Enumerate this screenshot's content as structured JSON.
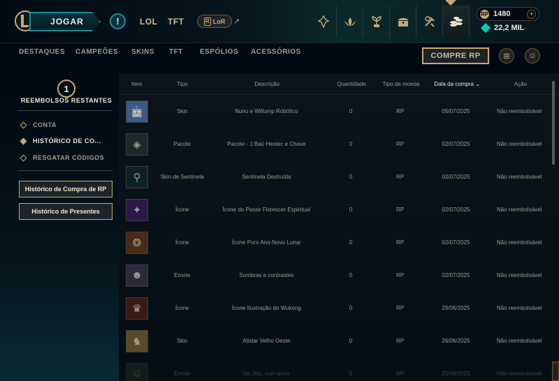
{
  "topbar": {
    "play_label": "JOGAR",
    "alert_label": "!",
    "game_tabs": [
      "LOL",
      "TFT"
    ],
    "lor_label": "LoR",
    "lor_badge": "R",
    "ext_arrow": "↗",
    "rp_amount": "1480",
    "rp_coin": "RP",
    "rp_plus": "+",
    "blue_essence": "22,2 MIL",
    "nav_icons": [
      "home-icon",
      "lotus-icon",
      "plant-icon",
      "chest-icon",
      "crafting-icon",
      "store-icon"
    ]
  },
  "store_tabs": [
    "DESTAQUES",
    "CAMPEÕES",
    "SKINS",
    "TFT",
    "ESPÓLIOS",
    "ACESSÓRIOS"
  ],
  "buy_rp_label": "COMPRE RP",
  "gift_icon_glyph": "⊞",
  "friends_icon_glyph": "☺",
  "sidebar": {
    "refund_count": "1",
    "refund_label": "REEMBOLSOS RESTANTES",
    "items": [
      {
        "label": "CONTA"
      },
      {
        "label": "HISTÓRICO DE CO..."
      },
      {
        "label": "RESGATAR CÓDIGOS"
      }
    ],
    "buttons": [
      "Histórico de Compra de RP",
      "Histórico de Presentes"
    ]
  },
  "table": {
    "headers": {
      "item": "Item",
      "tipo": "Tipo",
      "descricao": "Descrição",
      "quantidade": "Quantidade",
      "moeda": "Tipo de moeda",
      "data": "Data da compra",
      "sort_icon": "⌄",
      "acao": "Ação"
    },
    "rows": [
      {
        "thumb": "🤖",
        "bg": "#3b5a8a",
        "tipo": "Skin",
        "descricao": "Nunu e Willump Robótico",
        "quantidade": "0",
        "moeda": "RP",
        "data": "05/07/2025",
        "acao": "Não reembolsável"
      },
      {
        "thumb": "◈",
        "bg": "#1a2a2a",
        "tipo": "Pacote",
        "descricao": "Pacote - 1 Baú Hextec e Chave",
        "quantidade": "0",
        "moeda": "RP",
        "data": "02/07/2025",
        "acao": "Não reembolsável"
      },
      {
        "thumb": "⚲",
        "bg": "#0c2226",
        "tipo": "Skin de Sentinela",
        "descricao": "Sentinela Destruída",
        "quantidade": "0",
        "moeda": "RP",
        "data": "02/07/2025",
        "acao": "Não reembolsável"
      },
      {
        "thumb": "✦",
        "bg": "#2a1a4a",
        "tipo": "Ícone",
        "descricao": "Ícone do Passe Florescer Espiritual",
        "quantidade": "0",
        "moeda": "RP",
        "data": "02/07/2025",
        "acao": "Não reembolsável"
      },
      {
        "thumb": "❂",
        "bg": "#4a2a14",
        "tipo": "Ícone",
        "descricao": "Ícone Poro Ano-Novo Lunar",
        "quantidade": "0",
        "moeda": "RP",
        "data": "02/07/2025",
        "acao": "Não reembolsável"
      },
      {
        "thumb": "☻",
        "bg": "#2a2a3a",
        "tipo": "Emote",
        "descricao": "Sombras e contrastes",
        "quantidade": "0",
        "moeda": "RP",
        "data": "02/07/2025",
        "acao": "Não reembolsável"
      },
      {
        "thumb": "♛",
        "bg": "#3a1a14",
        "tipo": "Ícone",
        "descricao": "Ícone Ilustração do Wukong",
        "quantidade": "0",
        "moeda": "RP",
        "data": "29/06/2025",
        "acao": "Não reembolsável"
      },
      {
        "thumb": "♞",
        "bg": "#5a4a2a",
        "tipo": "Skin",
        "descricao": "Alistar Velho Oeste",
        "quantidade": "0",
        "moeda": "RP",
        "data": "26/06/2025",
        "acao": "Não reembolsável"
      },
      {
        "thumb": "☺",
        "bg": "#2a3a2a",
        "tipo": "Emote",
        "descricao": "Da Jinx, com amor",
        "quantidade": "0",
        "moeda": "RP",
        "data": "25/06/2025",
        "acao": "Não reembolsável"
      }
    ]
  }
}
